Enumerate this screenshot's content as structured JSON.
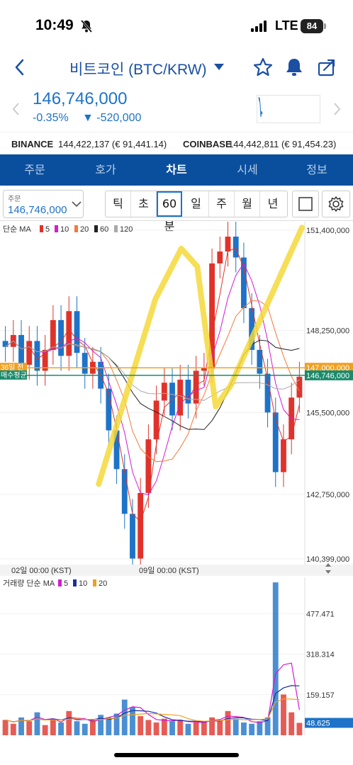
{
  "status": {
    "time": "10:49",
    "network": "LTE",
    "battery": "84"
  },
  "header": {
    "title": "비트코인 (BTC/KRW)"
  },
  "price": {
    "current": "146,746,000",
    "change_pct": "-0.35%",
    "change_abs": "▼ -520,000"
  },
  "exchanges": [
    {
      "name": "BINANCE",
      "price": "144,422,137 (€ 91,441.14)"
    },
    {
      "name": "COINBASE",
      "price": "144,442,811 (€ 91,454.23)"
    }
  ],
  "tabs": [
    "주문",
    "호가",
    "차트",
    "시세",
    "정보"
  ],
  "active_tab": "차트",
  "toolbar": {
    "order_label": "주문",
    "order_value": "146,746,000",
    "periods": [
      "틱",
      "초",
      "60분",
      "일",
      "주",
      "월",
      "년"
    ],
    "active_period": "60분"
  },
  "colors": {
    "up": "#e0322b",
    "down": "#1e73c8",
    "brand": "#0a4f9e",
    "ma5": "#e0322b",
    "ma10": "#d41ad4",
    "ma20": "#f27a3a",
    "ma60": "#222222",
    "ma120": "#aaaaaa",
    "vol_ma5": "#d41ad4",
    "vol_ma10": "#1a2f9e",
    "vol_ma20": "#f0a020",
    "highlight": "#f5d83a"
  },
  "chart_data": {
    "type": "candlestick",
    "price_legend": {
      "title": "단순 MA",
      "items": [
        "5",
        "10",
        "20",
        "60",
        "120"
      ]
    },
    "y_ticks": [
      "151,400,000",
      "148,250,000",
      "145,500,000",
      "142,750,000",
      "140,399,000"
    ],
    "ylim": [
      140399000,
      151900000
    ],
    "price_lines": [
      {
        "label": "36일 전",
        "value": "147,000,000",
        "numeric": 147000000,
        "color": "#f0a020"
      },
      {
        "label": "매수평균",
        "value": "146,746,000",
        "numeric": 146746000,
        "color": "#1a8a6a"
      }
    ],
    "x_ticks": [
      "02일 00:00 (KST)",
      "09일 00:00 (KST)"
    ],
    "close_series": [
      147700000,
      148100000,
      147100000,
      147900000,
      146900000,
      147600000,
      148600000,
      147400000,
      148900000,
      147500000,
      146800000,
      147200000,
      146300000,
      144900000,
      143600000,
      142100000,
      140600000,
      142800000,
      144600000,
      145900000,
      146500000,
      145400000,
      146600000,
      145800000,
      146900000,
      147000000,
      150500000,
      150900000,
      151400000,
      150700000,
      149000000,
      147600000,
      146800000,
      145500000,
      143500000,
      144600000,
      146000000,
      146700000
    ],
    "volume_legend": {
      "title": "거래량 단순 MA",
      "items": [
        "5",
        "10",
        "20"
      ]
    },
    "volume_ticks": [
      "477.471",
      "318.314",
      "159.157",
      "48.625"
    ],
    "volume_ylim": [
      0,
      620
    ],
    "volumes": [
      60,
      45,
      70,
      55,
      90,
      40,
      65,
      50,
      95,
      55,
      45,
      60,
      80,
      70,
      85,
      140,
      110,
      75,
      60,
      50,
      65,
      55,
      60,
      45,
      50,
      55,
      70,
      60,
      95,
      65,
      50,
      45,
      55,
      70,
      600,
      160,
      90,
      48.625
    ]
  }
}
